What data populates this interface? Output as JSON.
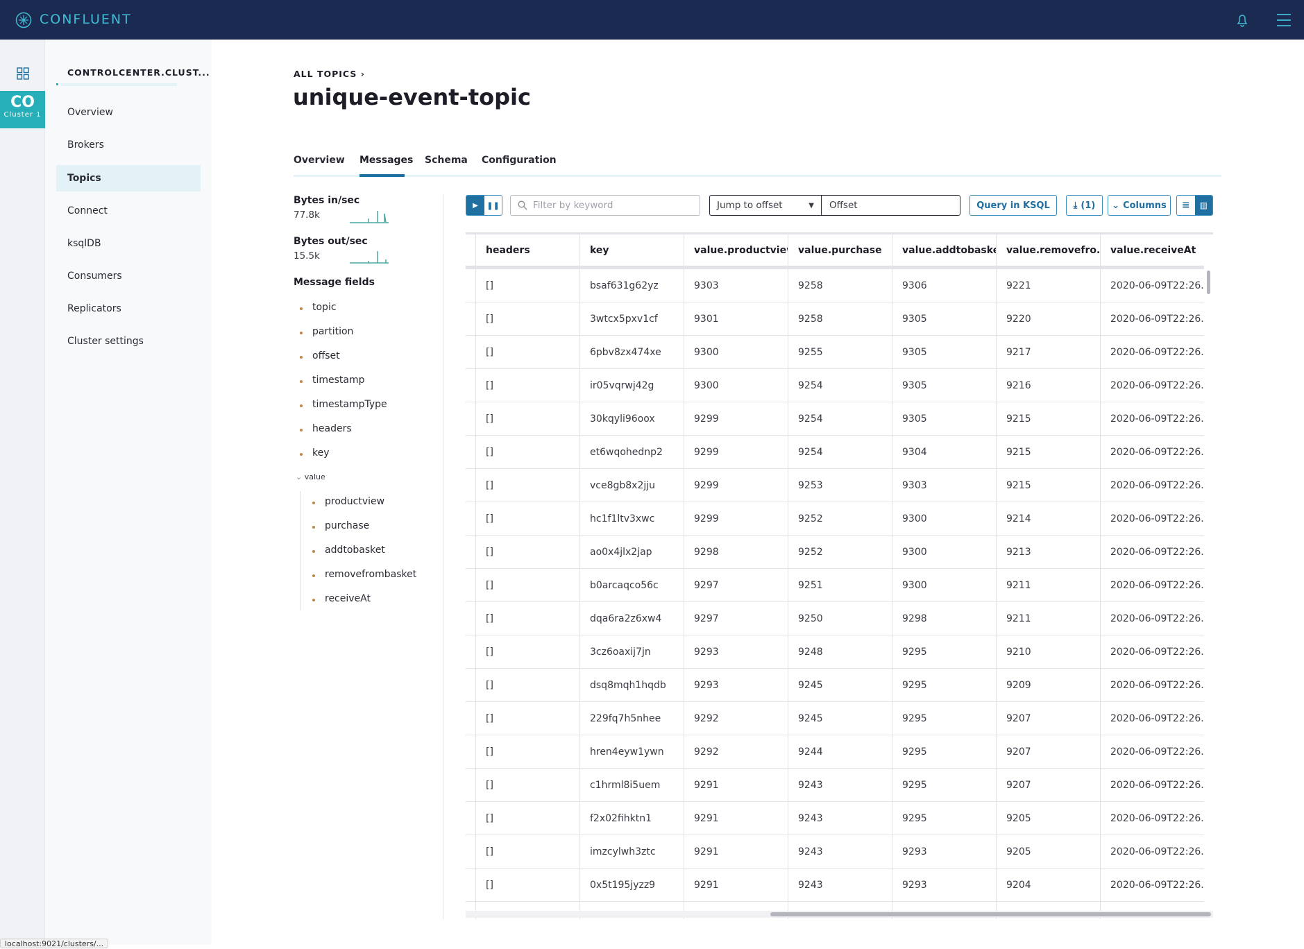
{
  "app": {
    "brand": "CONFLUENT"
  },
  "rail": {
    "cluster_abbr": "CO",
    "cluster_name": "Cluster 1"
  },
  "sidebar": {
    "title": "CONTROLCENTER.CLUST...",
    "items": [
      {
        "label": "Overview"
      },
      {
        "label": "Brokers"
      },
      {
        "label": "Topics",
        "active": true
      },
      {
        "label": "Connect"
      },
      {
        "label": "ksqlDB"
      },
      {
        "label": "Consumers"
      },
      {
        "label": "Replicators"
      },
      {
        "label": "Cluster settings"
      }
    ]
  },
  "breadcrumb": {
    "label": "ALL TOPICS",
    "sep": "›"
  },
  "page": {
    "title": "unique-event-topic"
  },
  "tabs": [
    {
      "label": "Overview"
    },
    {
      "label": "Messages",
      "active": true
    },
    {
      "label": "Schema"
    },
    {
      "label": "Configuration"
    }
  ],
  "stats": {
    "in_label": "Bytes in/sec",
    "in_value": "77.8k",
    "out_label": "Bytes out/sec",
    "out_value": "15.5k"
  },
  "fields": {
    "title": "Message fields",
    "items": [
      "topic",
      "partition",
      "offset",
      "timestamp",
      "timestampType",
      "headers",
      "key"
    ],
    "value_label": "value",
    "value_items": [
      "productview",
      "purchase",
      "addtobasket",
      "removefrombasket",
      "receiveAt"
    ]
  },
  "toolbar": {
    "filter_placeholder": "Filter by keyword",
    "jump_label": "Jump to offset",
    "offset_placeholder": "Offset",
    "query_label": "Query in KSQL",
    "download_label": "(1)",
    "columns_label": "Columns"
  },
  "table": {
    "columns": [
      "headers",
      "key",
      "value.productview",
      "value.purchase",
      "value.addtobasket",
      "value.removefro...",
      "value.receiveAt"
    ],
    "rows": [
      [
        "[]",
        "bsaf631g62yz",
        "9303",
        "9258",
        "9306",
        "9221",
        "2020-06-09T22:26..."
      ],
      [
        "[]",
        "3wtcx5pxv1cf",
        "9301",
        "9258",
        "9305",
        "9220",
        "2020-06-09T22:26..."
      ],
      [
        "[]",
        "6pbv8zx474xe",
        "9300",
        "9255",
        "9305",
        "9217",
        "2020-06-09T22:26..."
      ],
      [
        "[]",
        "ir05vqrwj42g",
        "9300",
        "9254",
        "9305",
        "9216",
        "2020-06-09T22:26..."
      ],
      [
        "[]",
        "30kqyli96oox",
        "9299",
        "9254",
        "9305",
        "9215",
        "2020-06-09T22:26..."
      ],
      [
        "[]",
        "et6wqohednp2",
        "9299",
        "9254",
        "9304",
        "9215",
        "2020-06-09T22:26..."
      ],
      [
        "[]",
        "vce8gb8x2jju",
        "9299",
        "9253",
        "9303",
        "9215",
        "2020-06-09T22:26..."
      ],
      [
        "[]",
        "hc1f1ltv3xwc",
        "9299",
        "9252",
        "9300",
        "9214",
        "2020-06-09T22:26..."
      ],
      [
        "[]",
        "ao0x4jlx2jap",
        "9298",
        "9252",
        "9300",
        "9213",
        "2020-06-09T22:26..."
      ],
      [
        "[]",
        "b0arcaqco56c",
        "9297",
        "9251",
        "9300",
        "9211",
        "2020-06-09T22:26..."
      ],
      [
        "[]",
        "dqa6ra2z6xw4",
        "9297",
        "9250",
        "9298",
        "9211",
        "2020-06-09T22:26..."
      ],
      [
        "[]",
        "3cz6oaxij7jn",
        "9293",
        "9248",
        "9295",
        "9210",
        "2020-06-09T22:26..."
      ],
      [
        "[]",
        "dsq8mqh1hqdb",
        "9293",
        "9245",
        "9295",
        "9209",
        "2020-06-09T22:26..."
      ],
      [
        "[]",
        "229fq7h5nhee",
        "9292",
        "9245",
        "9295",
        "9207",
        "2020-06-09T22:26..."
      ],
      [
        "[]",
        "hren4eyw1ywn",
        "9292",
        "9244",
        "9295",
        "9207",
        "2020-06-09T22:26..."
      ],
      [
        "[]",
        "c1hrml8i5uem",
        "9291",
        "9243",
        "9295",
        "9207",
        "2020-06-09T22:26..."
      ],
      [
        "[]",
        "f2x02fihktn1",
        "9291",
        "9243",
        "9295",
        "9205",
        "2020-06-09T22:26..."
      ],
      [
        "[]",
        "imzcylwh3ztc",
        "9291",
        "9243",
        "9293",
        "9205",
        "2020-06-09T22:26..."
      ],
      [
        "[]",
        "0x5t195jyzz9",
        "9291",
        "9243",
        "9293",
        "9204",
        "2020-06-09T22:26..."
      ]
    ]
  },
  "status": {
    "url": "localhost:9021/clusters/..."
  },
  "colors": {
    "header": "#1a2a50",
    "accent": "#26afb8",
    "link": "#1f6fa1"
  }
}
